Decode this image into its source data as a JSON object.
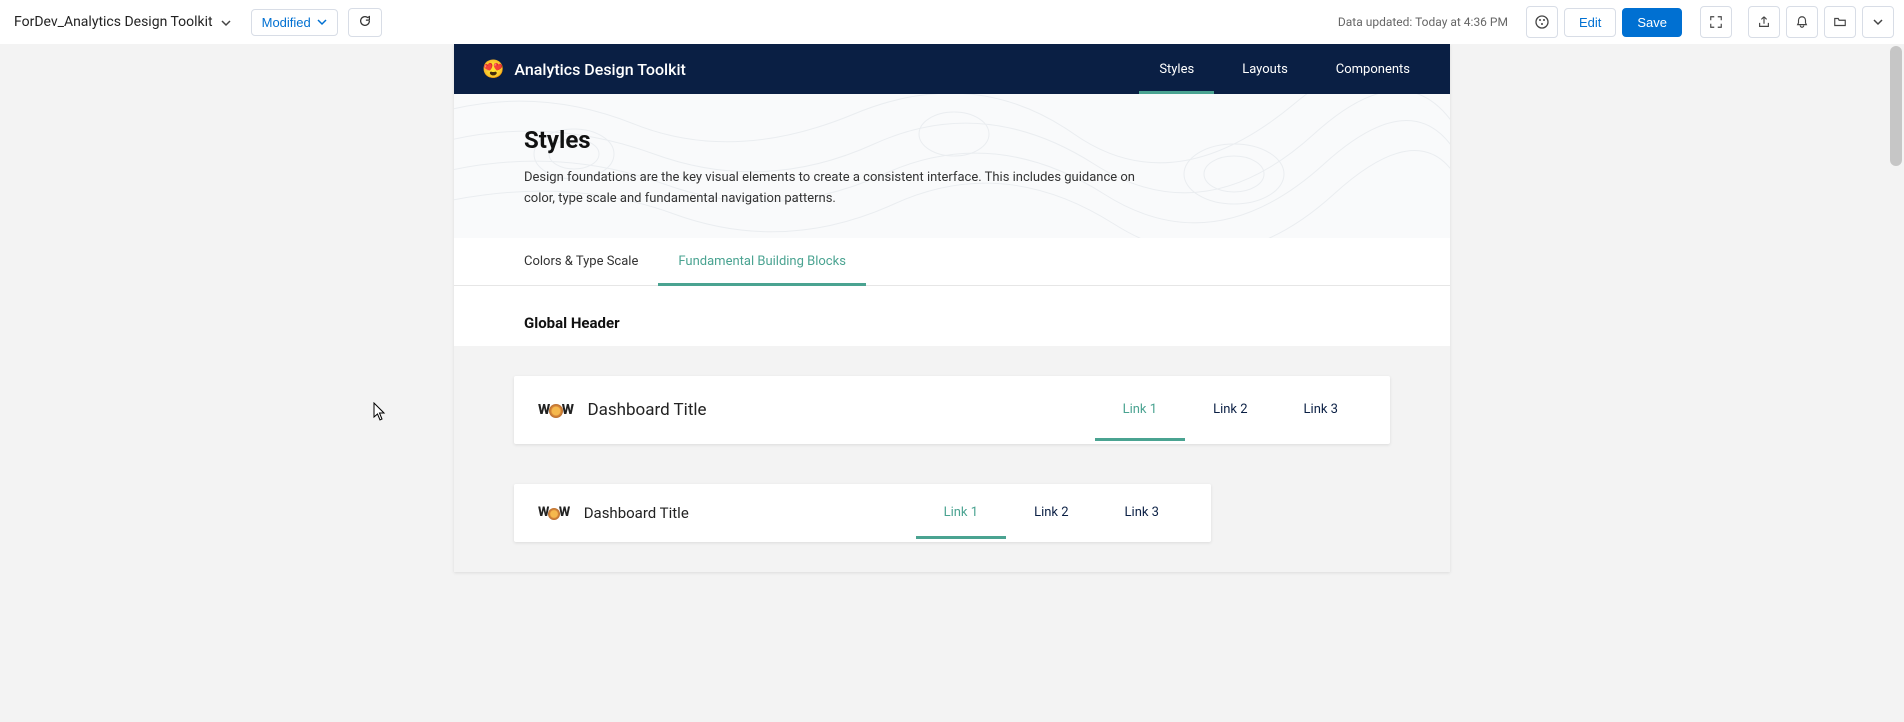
{
  "toolbar": {
    "doc_title": "ForDev_Analytics Design Toolkit",
    "modified_label": "Modified",
    "data_updated": "Data updated: Today at 4:36 PM",
    "edit_label": "Edit",
    "save_label": "Save"
  },
  "navy": {
    "title": "Analytics Design Toolkit",
    "nav": [
      {
        "label": "Styles",
        "active": true
      },
      {
        "label": "Layouts",
        "active": false
      },
      {
        "label": "Components",
        "active": false
      }
    ]
  },
  "hero": {
    "title": "Styles",
    "desc": "Design foundations are the key visual elements to create a consistent interface. This includes guidance on color, type scale and fundamental navigation patterns."
  },
  "subtabs": [
    {
      "label": "Colors & Type Scale",
      "active": false
    },
    {
      "label": "Fundamental Building Blocks",
      "active": true
    }
  ],
  "section_title": "Global Header",
  "example_header": {
    "title": "Dashboard Title",
    "links": [
      {
        "label": "Link 1",
        "active": true
      },
      {
        "label": "Link 2",
        "active": false
      },
      {
        "label": "Link 3",
        "active": false
      }
    ]
  },
  "colors": {
    "navy": "#0a1f44",
    "teal": "#4aa391",
    "primary_blue": "#0070d2"
  }
}
